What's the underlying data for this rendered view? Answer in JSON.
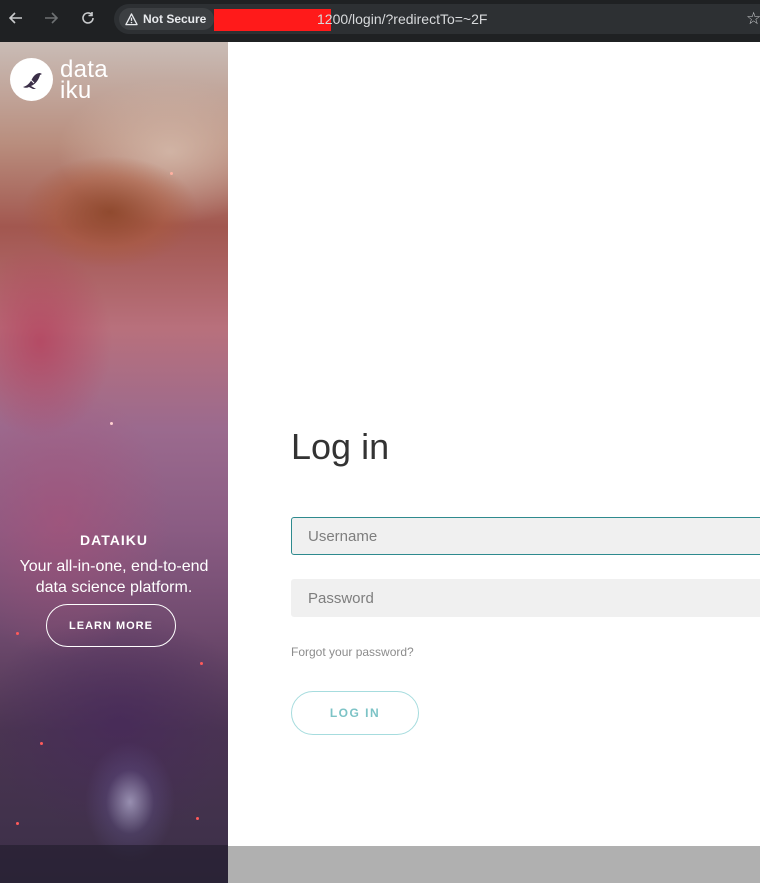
{
  "browser": {
    "security_label": "Not Secure",
    "url_visible": "1200/login/?redirectTo=~2F",
    "icons": [
      "back-arrow-icon",
      "forward-arrow-icon",
      "reload-icon",
      "warning-icon",
      "bookmark-star-icon"
    ]
  },
  "brand": {
    "logo_line1": "data",
    "logo_line2": "iku",
    "tag_title": "DATAIKU",
    "tag_line1": "Your all-in-one, end-to-end",
    "tag_line2": "data science platform.",
    "learn_more": "LEARN MORE"
  },
  "login": {
    "title": "Log in",
    "username_placeholder": "Username",
    "password_placeholder": "Password",
    "forgot": "Forgot your password?",
    "button": "LOG IN"
  },
  "colors": {
    "accent": "#2e8a8e",
    "button_text": "#7cc3c6",
    "redaction": "#ff1a1a"
  }
}
